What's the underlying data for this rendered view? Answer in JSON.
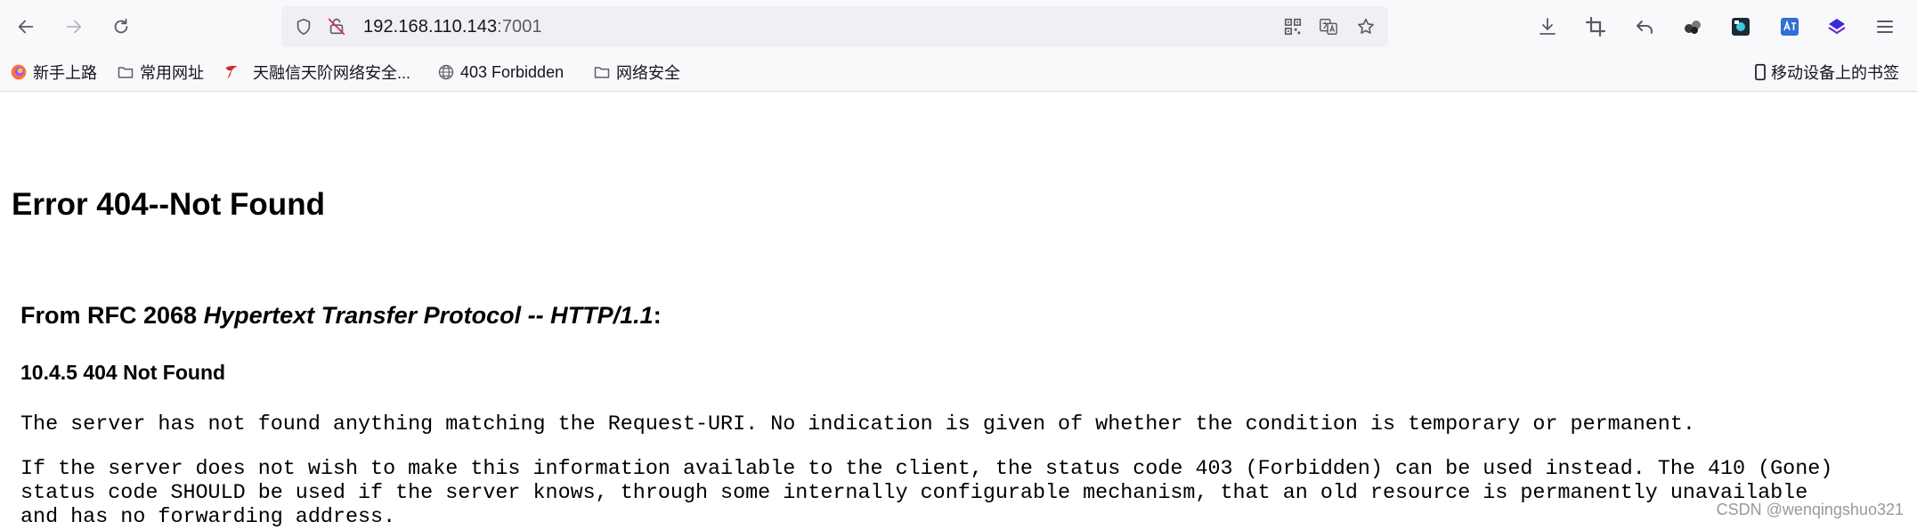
{
  "urlbar": {
    "host": "192.168.110.143",
    "port": ":7001"
  },
  "bookmarks": [
    {
      "label": "新手上路",
      "icon": "firefox-icon"
    },
    {
      "label": "常用网址",
      "icon": "folder-icon"
    },
    {
      "label": "天融信天阶网络安全...",
      "icon": "topsec-icon"
    },
    {
      "label": "403 Forbidden",
      "icon": "globe-icon"
    },
    {
      "label": "网络安全",
      "icon": "folder-icon"
    }
  ],
  "mobile_bookmarks": "移动设备上的书签",
  "page": {
    "heading": "Error 404--Not Found",
    "rfc_prefix": "From RFC 2068 ",
    "rfc_title": "Hypertext Transfer Protocol -- HTTP/1.1",
    "rfc_suffix": ":",
    "section": "10.4.5 404 Not Found",
    "para1": "The server has not found anything matching the Request-URI. No indication is given of whether the condition is temporary or permanent.",
    "para2": "If the server does not wish to make this information available to the client, the status code 403 (Forbidden) can be used instead. The 410 (Gone)\nstatus code SHOULD be used if the server knows, through some internally configurable mechanism, that an old resource is permanently unavailable\nand has no forwarding address."
  },
  "watermark": "CSDN @wenqingshuo321",
  "colors": {
    "toolbar_bg": "#f9f9fb",
    "urlbar_bg": "#f0f0f4",
    "icon": "#5b5b66"
  }
}
